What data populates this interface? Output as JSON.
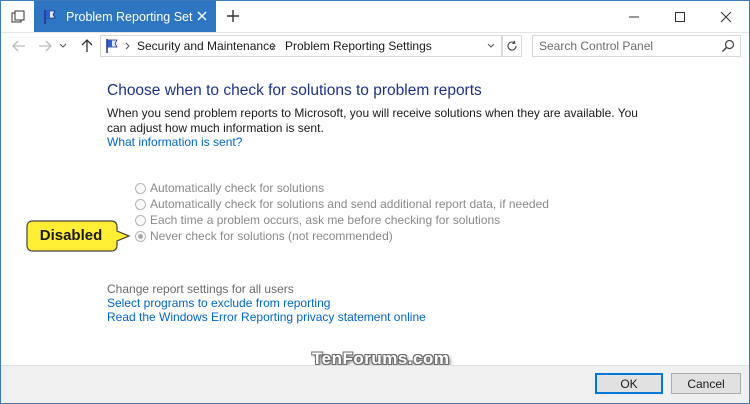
{
  "titlebar": {
    "tab_title": "Problem Reporting Set",
    "new_tab_label": "+"
  },
  "address": {
    "breadcrumbs": [
      "Security and Maintenance",
      "Problem Reporting Settings"
    ],
    "search_placeholder": "Search Control Panel"
  },
  "content": {
    "heading": "Choose when to check for solutions to problem reports",
    "description": "When you send problem reports to Microsoft, you will receive solutions when they are available. You can adjust how much information is sent.",
    "what_info_link": "What information is sent?",
    "options": [
      {
        "label": "Automatically check for solutions",
        "checked": false,
        "enabled": false
      },
      {
        "label": "Automatically check for solutions and send additional report data, if needed",
        "checked": false,
        "enabled": false
      },
      {
        "label": "Each time a problem occurs, ask me before checking for solutions",
        "checked": false,
        "enabled": false
      },
      {
        "label": "Never check for solutions (not recommended)",
        "checked": true,
        "enabled": false
      }
    ],
    "callout": "Disabled",
    "see_also_title": "Change report settings for all users",
    "links": {
      "programs": "Select programs to exclude from reporting",
      "privacy": "Read the Windows Error Reporting privacy statement online"
    },
    "watermark": "TenForums.com"
  },
  "footer": {
    "ok_label": "OK",
    "cancel_label": "Cancel"
  },
  "colors": {
    "tab_active": "#2f76c2",
    "heading": "#1e3287",
    "link": "#0066cc",
    "callout_fill": "#ffee33",
    "disabled_text": "#8a8a8a"
  },
  "icons": {
    "system_menu": "window-tabs-icon",
    "tab": "flag-icon",
    "back": "arrow-left-icon",
    "forward": "arrow-right-icon",
    "recent": "chevron-down-icon",
    "up": "arrow-up-icon",
    "refresh": "refresh-icon",
    "search": "search-icon"
  }
}
